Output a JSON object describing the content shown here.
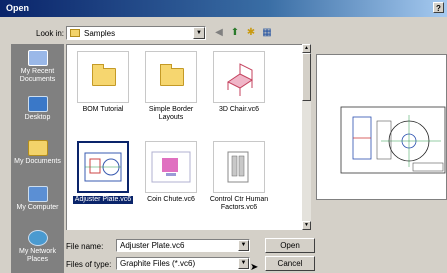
{
  "dialog": {
    "title": "Open",
    "help": "?"
  },
  "look_in": {
    "label": "Look in:",
    "value": "Samples"
  },
  "places": [
    {
      "label": "My Recent Documents",
      "icon": "recent-documents-icon"
    },
    {
      "label": "Desktop",
      "icon": "desktop-icon"
    },
    {
      "label": "My Documents",
      "icon": "my-documents-icon"
    },
    {
      "label": "My Computer",
      "icon": "my-computer-icon"
    },
    {
      "label": "My Network Places",
      "icon": "network-places-icon"
    }
  ],
  "files": [
    {
      "name": "BOM Tutorial",
      "kind": "folder"
    },
    {
      "name": "Simple Border Layouts",
      "kind": "folder"
    },
    {
      "name": "3D Chair.vc6",
      "kind": "drawing"
    },
    {
      "name": "Adjuster Plate.vc6",
      "kind": "drawing",
      "selected": true
    },
    {
      "name": "Coin Chute.vc6",
      "kind": "drawing"
    },
    {
      "name": "Control Ctr Human Factors.vc6",
      "kind": "drawing"
    }
  ],
  "file_name": {
    "label": "File name:",
    "value": "Adjuster Plate.vc6"
  },
  "file_type": {
    "label": "Files of type:",
    "value": "Graphite Files (*.vc6)"
  },
  "buttons": {
    "open": "Open",
    "cancel": "Cancel"
  }
}
